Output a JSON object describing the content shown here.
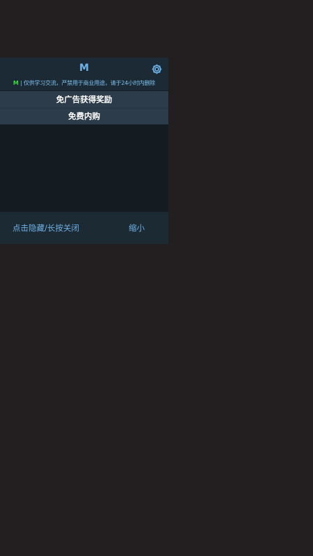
{
  "panel": {
    "title": "M",
    "notice_prefix": "M",
    "notice_separator": "|",
    "notice_text": "仅供学习交流，严禁用于商业用途，请于24小时内删除",
    "menu_items": [
      {
        "label": "免广告获得奖励"
      },
      {
        "label": "免费内购"
      }
    ],
    "footer": {
      "hide_label": "点击隐藏/长按关闭",
      "minimize_label": "缩小"
    },
    "icons": {
      "settings": "gear-icon"
    },
    "colors": {
      "accent": "#6fb3e8",
      "notice_prefix": "#3ddc3d",
      "header_bg": "#1b2a35",
      "menu_bg": "#2c3c4a",
      "body_bg": "#141c22",
      "page_bg": "#231f20"
    }
  }
}
